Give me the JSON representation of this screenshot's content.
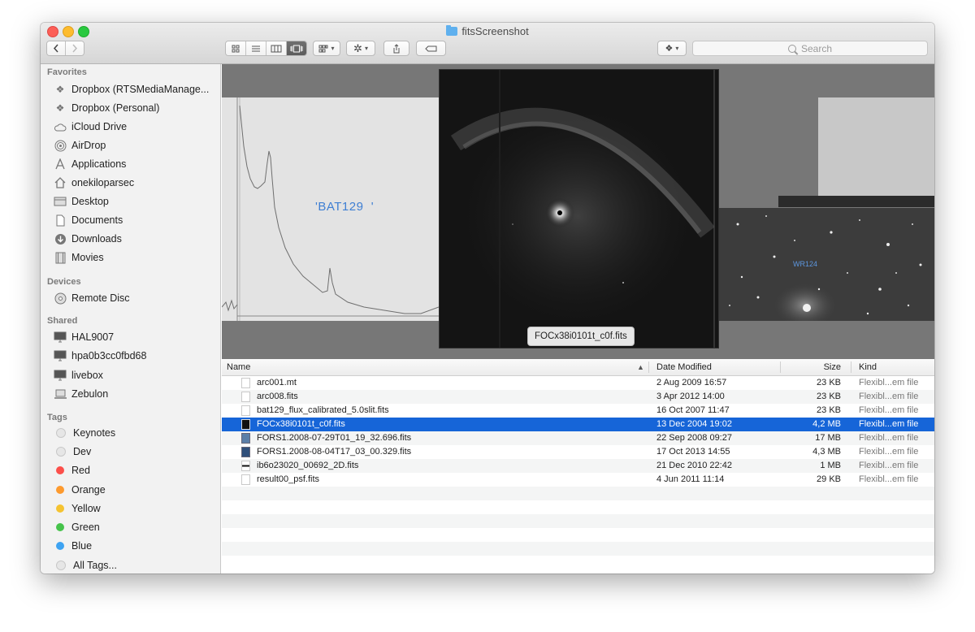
{
  "window": {
    "title": "fitsScreenshot"
  },
  "toolbar": {
    "view_icon": "icon-view-icon",
    "list_view_icon": "list-view-icon",
    "column_view_icon": "column-view-icon",
    "coverflow_view_icon": "coverflow-view-icon",
    "arrange_icon": "arrange-icon",
    "action_icon": "gear-icon",
    "share_icon": "share-icon",
    "tag_icon": "tag-icon",
    "dropbox_icon": "dropbox-icon",
    "search_placeholder": "Search"
  },
  "sidebar": {
    "favorites_heading": "Favorites",
    "favorites": [
      {
        "label": "Dropbox (RTSMediaManage...",
        "icon": "dropbox-icon"
      },
      {
        "label": "Dropbox (Personal)",
        "icon": "dropbox-icon"
      },
      {
        "label": "iCloud Drive",
        "icon": "cloud-icon"
      },
      {
        "label": "AirDrop",
        "icon": "airdrop-icon"
      },
      {
        "label": "Applications",
        "icon": "applications-icon"
      },
      {
        "label": "onekiloparsec",
        "icon": "home-icon"
      },
      {
        "label": "Desktop",
        "icon": "desktop-icon"
      },
      {
        "label": "Documents",
        "icon": "documents-icon"
      },
      {
        "label": "Downloads",
        "icon": "downloads-icon"
      },
      {
        "label": "Movies",
        "icon": "movies-icon"
      }
    ],
    "devices_heading": "Devices",
    "devices": [
      {
        "label": "Remote Disc",
        "icon": "disc-icon"
      }
    ],
    "shared_heading": "Shared",
    "shared": [
      {
        "label": "HAL9007",
        "icon": "display-icon"
      },
      {
        "label": "hpa0b3cc0fbd68",
        "icon": "display-icon"
      },
      {
        "label": "livebox",
        "icon": "display-icon"
      },
      {
        "label": "Zebulon",
        "icon": "laptop-icon"
      }
    ],
    "tags_heading": "Tags",
    "tags": [
      {
        "label": "Keynotes",
        "color": "#e0e0e0"
      },
      {
        "label": "Dev",
        "color": "#e0e0e0"
      },
      {
        "label": "Red",
        "color": "#fc4f4a"
      },
      {
        "label": "Orange",
        "color": "#fd9a2e"
      },
      {
        "label": "Yellow",
        "color": "#f5c331"
      },
      {
        "label": "Green",
        "color": "#46c34b"
      },
      {
        "label": "Blue",
        "color": "#3ea3f2"
      },
      {
        "label": "All Tags...",
        "color": "#e0e0e0"
      }
    ]
  },
  "preview": {
    "left_label": "'BAT129  '",
    "right_label": "WR124",
    "caption": "FOCx38i0101t_c0f.fits"
  },
  "list": {
    "columns": {
      "name": "Name",
      "date": "Date Modified",
      "size": "Size",
      "kind": "Kind"
    },
    "rows": [
      {
        "name": "arc001.mt",
        "date": "2 Aug 2009 16:57",
        "size": "23 KB",
        "kind": "Flexibl...em file"
      },
      {
        "name": "arc008.fits",
        "date": "3 Apr 2012 14:00",
        "size": "23 KB",
        "kind": "Flexibl...em file"
      },
      {
        "name": "bat129_flux_calibrated_5.0slit.fits",
        "date": "16 Oct 2007 11:47",
        "size": "23 KB",
        "kind": "Flexibl...em file"
      },
      {
        "name": "FOCx38i0101t_c0f.fits",
        "date": "13 Dec 2004 19:02",
        "size": "4,2 MB",
        "kind": "Flexibl...em file"
      },
      {
        "name": "FORS1.2008-07-29T01_19_32.696.fits",
        "date": "22 Sep 2008 09:27",
        "size": "17 MB",
        "kind": "Flexibl...em file"
      },
      {
        "name": "FORS1.2008-08-04T17_03_00.329.fits",
        "date": "17 Oct 2013 14:55",
        "size": "4,3 MB",
        "kind": "Flexibl...em file"
      },
      {
        "name": "ib6o23020_00692_2D.fits",
        "date": "21 Dec 2010 22:42",
        "size": "1 MB",
        "kind": "Flexibl...em file"
      },
      {
        "name": "result00_psf.fits",
        "date": "4 Jun 2011 11:14",
        "size": "29 KB",
        "kind": "Flexibl...em file"
      }
    ],
    "selected_index": 3,
    "colors": {
      "selection": "#1665d8"
    }
  }
}
